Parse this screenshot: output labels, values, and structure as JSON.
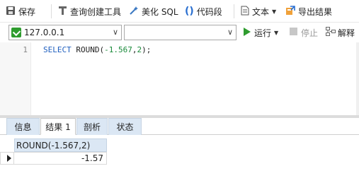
{
  "toolbar": {
    "save_label": "保存",
    "query_builder_label": "查询创建工具",
    "beautify_label": "美化 SQL",
    "snippet_label": "代码段",
    "text_label": "文本",
    "export_label": "导出结果"
  },
  "connection": {
    "host": "127.0.0.1",
    "database": ""
  },
  "run_bar": {
    "run_label": "运行",
    "stop_label": "停止",
    "explain_label": "解释"
  },
  "editor": {
    "line_numbers": [
      "1"
    ],
    "sql_keyword": "SELECT",
    "sql_function": "ROUND(",
    "sql_arg1": "-1.567",
    "sql_comma": ",",
    "sql_arg2": "2",
    "sql_end": ");"
  },
  "result_tabs": [
    {
      "label": "信息"
    },
    {
      "label": "结果 1"
    },
    {
      "label": "剖析"
    },
    {
      "label": "状态"
    }
  ],
  "result_grid": {
    "columns": [
      "ROUND(-1.567,2)"
    ],
    "rows": [
      [
        "-1.57"
      ]
    ]
  },
  "colors": {
    "run_green": "#2e9c2e",
    "header_blue": "#dbe7f4",
    "keyword_blue": "#1f5fbf"
  }
}
